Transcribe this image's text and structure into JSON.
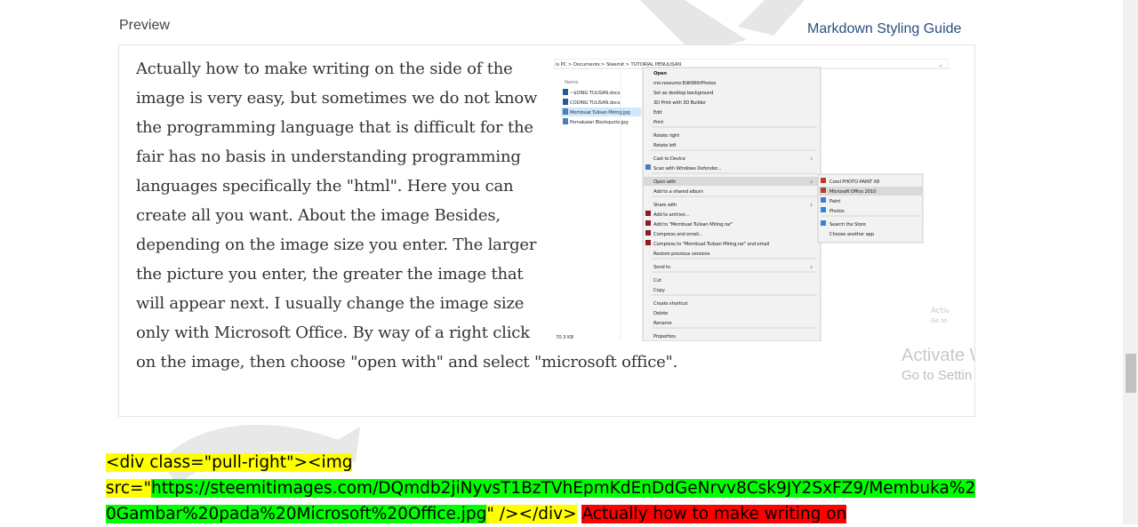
{
  "header": {
    "preview_label": "Preview",
    "guide_link": "Markdown Styling Guide"
  },
  "preview": {
    "paragraph": "Actually how to make writing on the side of the image is very easy, but sometimes we do not know the programming language that is difficult for the fair has no basis in understanding programming languages specifically the \"html\". Here you can create all you want. About the image Besides, depending on the image size you enter. The larger the picture you enter, the greater the image that will appear next. I usually change the image size only with Microsoft Office. By way of a right click on the image, then choose \"open with\" and select \"microsoft office\".",
    "image": {
      "breadcrumb": "is PC  >  Documents  >  Steemit  >  TUTORIAL PENULISAN",
      "column_name": "Name",
      "files": [
        "~$DING TULISAN.docx",
        "CODING TULISAN.docx",
        "Membuat Tulisan Miring.jpg",
        "Pemakaian Blockquote.jpg"
      ],
      "file_size": "70.3 KB",
      "context_menu": [
        "Open",
        "mo-resource:EditWithPhotos",
        "Set as desktop background",
        "3D Print with 3D Builder",
        "Edit",
        "Print",
        "Rotate right",
        "Rotate left",
        "Cast to Device",
        "Scan with Windows Defender...",
        "Open with",
        "Add to a shared album",
        "Share with",
        "Add to archive...",
        "Add to \"Membuat Tulisan Miring.rar\"",
        "Compress and email...",
        "Compress to \"Membuat Tulisan Miring.rar\" and email",
        "Restore previous versions",
        "Send to",
        "Cut",
        "Copy",
        "Create shortcut",
        "Delete",
        "Rename",
        "Properties"
      ],
      "submenu": [
        "Corel PHOTO-PAINT X8",
        "Microsoft Office 2010",
        "Paint",
        "Photos",
        "Search the Store",
        "Choose another app"
      ],
      "activate_hint_1": "Activ",
      "activate_hint_2": "Go to S"
    },
    "activate_line1": "Activate W",
    "activate_line2": "Go to Settin"
  },
  "code": {
    "part1": "<div class=\"pull-right\"><img",
    "part2": "src=\"",
    "url": "https://steemitimages.com/DQmdb2jiNyvsT1BzTVhEpmKdEnDdGeNrvv8Csk9JY2SxFZ9/Membuka%20Gambar%20pada%20Microsoft%20Office.jpg",
    "part3": "\" /></div>",
    "red_text": "Actually how to make writing on"
  },
  "colors": {
    "highlight_yellow": "#ffff00",
    "highlight_green": "#00ff00",
    "highlight_red": "#ff0000",
    "link": "#2a4f7e"
  }
}
